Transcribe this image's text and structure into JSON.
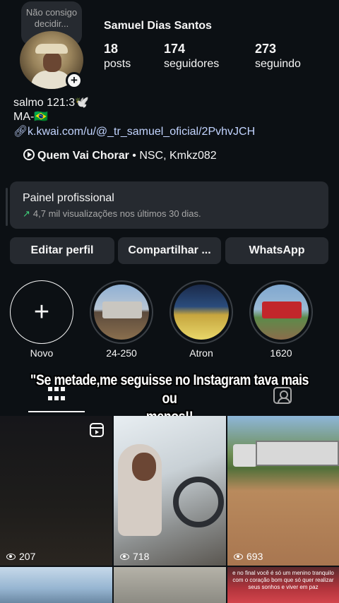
{
  "note": {
    "text": "Não consigo decidir..."
  },
  "profile": {
    "name": "Samuel Dias Santos",
    "stats": [
      {
        "value": "18",
        "label": "posts"
      },
      {
        "value": "174",
        "label": "seguidores"
      },
      {
        "value": "273",
        "label": "seguindo"
      }
    ]
  },
  "bio": {
    "line1": "salmo 121:3🕊️",
    "line2": "MA-🇧🇷",
    "link": "k.kwai.com/u/@_tr_samuel_oficial/2PvhvJCH",
    "music_title": "Quem Vai Chorar",
    "music_artists": " • NSC, Kmkz082"
  },
  "pro_panel": {
    "title": "Painel profissional",
    "subtitle": "4,7 mil visualizações nos últimos 30 dias."
  },
  "actions": {
    "edit": "Editar perfil",
    "share": "Compartilhar ...",
    "whatsapp": "WhatsApp"
  },
  "highlights": [
    {
      "label": "Novo"
    },
    {
      "label": "24-250"
    },
    {
      "label": "Atron"
    },
    {
      "label": "1620"
    }
  ],
  "caption": {
    "line1": "\"Se metade,me  seguisse no Instagram tava mais ou",
    "line2": "menos!!"
  },
  "posts": [
    {
      "views": "207"
    },
    {
      "views": "718"
    },
    {
      "views": "693"
    }
  ],
  "post6_text": "e no final você é só um menino tranquilo com o coração bom que só quer realizar seus sonhos e viver em paz",
  "colors": {
    "background": "#0c1014",
    "panel": "#262a30",
    "link": "#c2d4ff",
    "accent_green": "#3fd17a"
  }
}
